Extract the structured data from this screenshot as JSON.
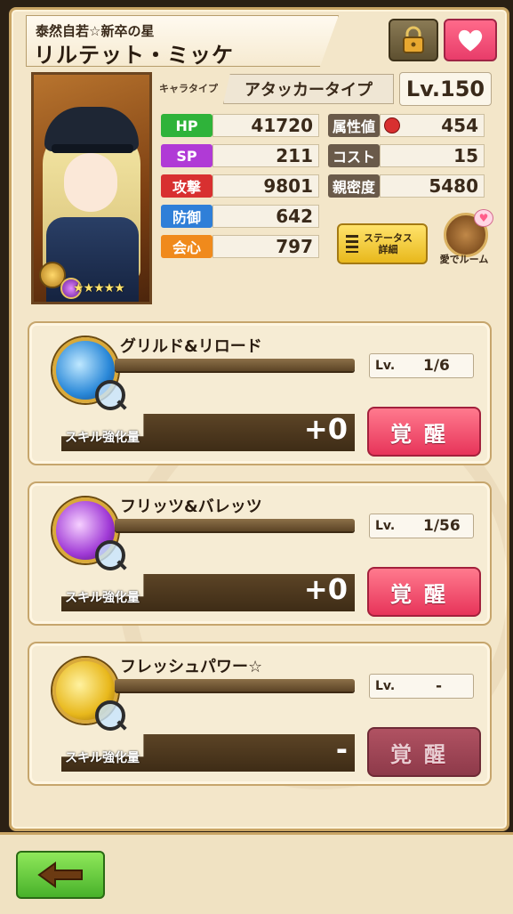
{
  "header": {
    "subtitle": "泰然自若☆新卒の星",
    "title": "リルテット・ミッケ"
  },
  "character": {
    "type_label": "キャラタイプ",
    "type_value": "アタッカータイプ",
    "level": "Lv.150",
    "rarity_stars": "★★★★★"
  },
  "stats_left": [
    {
      "label": "HP",
      "value": "41720",
      "color": "#2fb33a"
    },
    {
      "label": "SP",
      "value": "211",
      "color": "#b03ad6"
    },
    {
      "label": "攻撃",
      "value": "9801",
      "color": "#d83030"
    },
    {
      "label": "防御",
      "value": "642",
      "color": "#2f7fd8"
    },
    {
      "label": "会心",
      "value": "797",
      "color": "#f08a1c"
    }
  ],
  "stats_right": [
    {
      "label": "属性値",
      "value": "454",
      "color": "#6a5a4a"
    },
    {
      "label": "コスト",
      "value": "15",
      "color": "#6a5a4a"
    },
    {
      "label": "親密度",
      "value": "5480",
      "color": "#6a5a4a"
    }
  ],
  "buttons": {
    "status_detail_line1": "ステータス",
    "status_detail_line2": "詳細",
    "room": "愛でルーム"
  },
  "skills": [
    {
      "name": "グリルド&リロード",
      "lv_label": "Lv.",
      "lv_value": "1/6",
      "enh_label": "スキル強化量",
      "enh_value": "+0",
      "awaken": "覚醒",
      "icon": "blue-wing-icon"
    },
    {
      "name": "フリッツ&バレッツ",
      "lv_label": "Lv.",
      "lv_value": "1/56",
      "enh_label": "スキル強化量",
      "enh_value": "+0",
      "awaken": "覚醒",
      "icon": "purple-swirl-icon"
    },
    {
      "name": "フレッシュパワー☆",
      "lv_label": "Lv.",
      "lv_value": "-",
      "enh_label": "スキル強化量",
      "enh_value": "-",
      "awaken": "覚醒",
      "icon": "power-up-icon"
    }
  ]
}
